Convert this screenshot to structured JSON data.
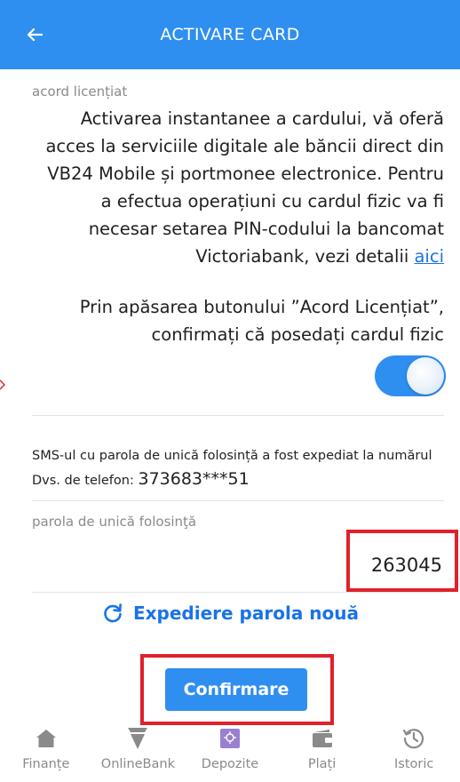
{
  "header": {
    "title": "ACTIVARE CARD",
    "back_icon": "arrow-left-icon"
  },
  "license": {
    "label": "acord licențiat",
    "text": "Activarea instantanee a cardului, vă oferă acces la serviciile digitale ale băncii direct din VB24 Mobile și portmonee electronice. Pentru a efectua operațiuni cu cardul fizic va fi necesar setarea PIN-codului la bancomat Victoriabank, vezi detalii ",
    "link_text": "aici"
  },
  "confirm_notice": "Prin apăsarea butonului ”Acord Licențiat”, confirmați că posedați cardul fizic",
  "toggle": {
    "state": "on"
  },
  "sms": {
    "text": "SMS-ul cu parola de unică folosință a fost expediat la numărul Dvs. de telefon: ",
    "phone": "373683***51"
  },
  "otp": {
    "label": "parola de unică folosinţă",
    "value": "263045"
  },
  "resend_label": "Expediere parola nouă",
  "confirm_button_label": "Confirmare",
  "nav": {
    "items": [
      {
        "label": "Finanțe",
        "icon": "home-icon"
      },
      {
        "label": "OnlineBank",
        "icon": "funnel-icon"
      },
      {
        "label": "Depozite",
        "icon": "deposit-icon"
      },
      {
        "label": "Plați",
        "icon": "wallet-icon"
      },
      {
        "label": "Istoric",
        "icon": "history-icon"
      }
    ]
  },
  "colors": {
    "primary": "#2f8ff0",
    "link": "#1a73e8",
    "highlight": "#e0212b"
  }
}
